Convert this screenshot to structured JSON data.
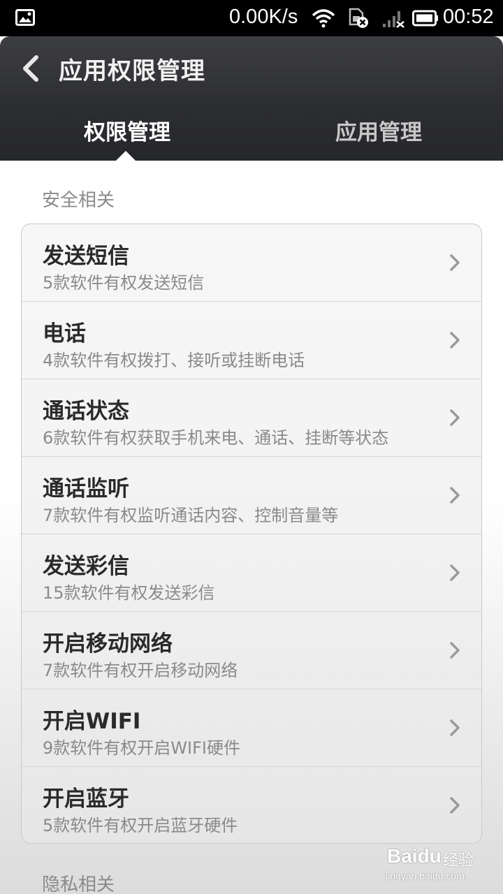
{
  "status_bar": {
    "network_speed": "0.00K/s",
    "time": "00:52",
    "icons": [
      "image-notification-icon",
      "wifi-icon",
      "sim-error-icon",
      "signal-icon",
      "battery-icon"
    ]
  },
  "header": {
    "title": "应用权限管理",
    "tabs": [
      {
        "label": "权限管理",
        "active": true
      },
      {
        "label": "应用管理",
        "active": false
      }
    ]
  },
  "sections": [
    {
      "label": "安全相关",
      "items": [
        {
          "title": "发送短信",
          "subtitle": "5款软件有权发送短信"
        },
        {
          "title": "电话",
          "subtitle": "4款软件有权拨打、接听或挂断电话"
        },
        {
          "title": "通话状态",
          "subtitle": "6款软件有权获取手机来电、通话、挂断等状态"
        },
        {
          "title": "通话监听",
          "subtitle": "7款软件有权监听通话内容、控制音量等"
        },
        {
          "title": "发送彩信",
          "subtitle": "15款软件有权发送彩信"
        },
        {
          "title": "开启移动网络",
          "subtitle": "7款软件有权开启移动网络"
        },
        {
          "title": "开启WIFI",
          "subtitle": "9款软件有权开启WIFI硬件"
        },
        {
          "title": "开启蓝牙",
          "subtitle": "5款软件有权开启蓝牙硬件"
        }
      ]
    },
    {
      "label": "隐私相关",
      "items": []
    }
  ],
  "watermark": {
    "logo": "Baidu",
    "product": "经验",
    "url": "jingyan.baidu.com"
  },
  "colors": {
    "header_bg": "#2c2d31",
    "tab_active": "#ffffff",
    "tab_inactive": "#c8c8c8",
    "section_label": "#8a8a8a"
  }
}
